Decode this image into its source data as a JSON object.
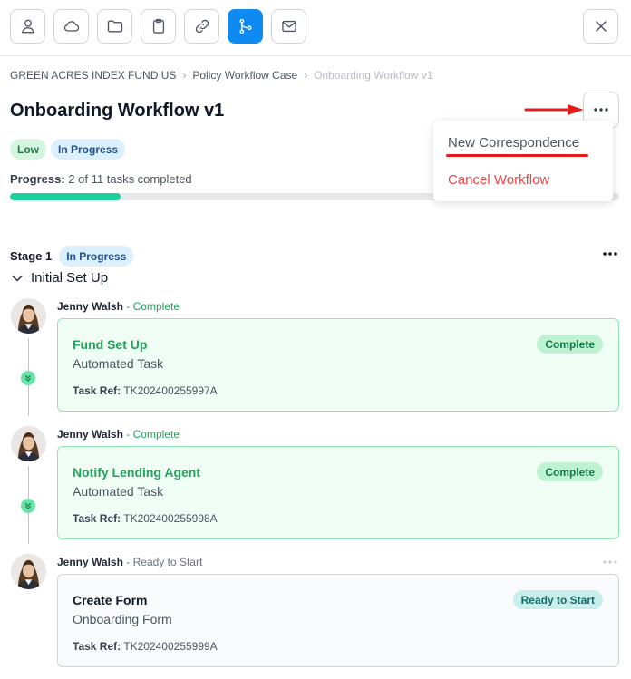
{
  "toolbar": {
    "buttons": [
      {
        "icon": "person-icon",
        "active": false
      },
      {
        "icon": "cloud-icon",
        "active": false
      },
      {
        "icon": "folder-icon",
        "active": false
      },
      {
        "icon": "clipboard-icon",
        "active": false
      },
      {
        "icon": "link-icon",
        "active": false
      },
      {
        "icon": "workflow-icon",
        "active": true
      },
      {
        "icon": "mail-icon",
        "active": false
      }
    ],
    "close_icon": "close-icon",
    "active_color": "#0d8bf2"
  },
  "breadcrumb": {
    "items": [
      "GREEN ACRES INDEX FUND US",
      "Policy Workflow Case",
      "Onboarding Workflow v1"
    ]
  },
  "header": {
    "title": "Onboarding Workflow v1",
    "badges": {
      "priority": "Low",
      "status": "In Progress"
    }
  },
  "progress": {
    "label": "Progress:",
    "text": "2 of 11 tasks completed",
    "completed": 2,
    "total": 11,
    "color": "#1ccf9c"
  },
  "menu": {
    "items": [
      "New Correspondence",
      "Cancel Workflow"
    ]
  },
  "stage": {
    "label": "Stage 1",
    "status": "In Progress",
    "group": "Initial Set Up"
  },
  "tasks": [
    {
      "owner": "Jenny Walsh",
      "owner_status": "Complete",
      "title": "Fund Set Up",
      "type": "Automated Task",
      "status": "Complete",
      "ref_label": "Task Ref:",
      "ref": "TK202400255997A"
    },
    {
      "owner": "Jenny Walsh",
      "owner_status": "Complete",
      "title": "Notify Lending Agent",
      "type": "Automated Task",
      "status": "Complete",
      "ref_label": "Task Ref:",
      "ref": "TK202400255998A"
    },
    {
      "owner": "Jenny Walsh",
      "owner_status": "Ready to Start",
      "title": "Create Form",
      "type": "Onboarding Form",
      "status": "Ready to Start",
      "ref_label": "Task Ref:",
      "ref": "TK202400255999A"
    }
  ],
  "separator": "-"
}
